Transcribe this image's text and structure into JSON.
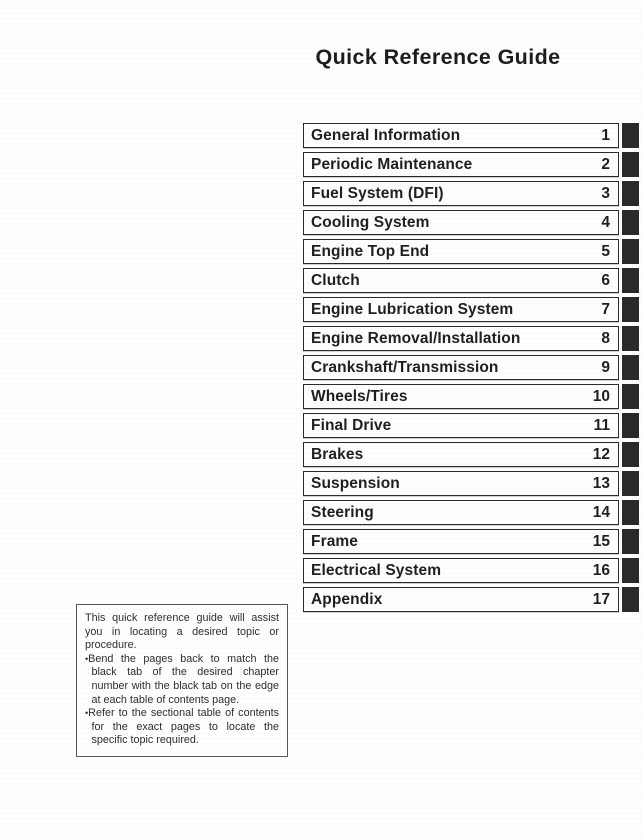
{
  "page": {
    "title": "Quick Reference Guide"
  },
  "chapters": [
    {
      "title": "General Information",
      "number": "1"
    },
    {
      "title": "Periodic Maintenance",
      "number": "2"
    },
    {
      "title": "Fuel System (DFI)",
      "number": "3"
    },
    {
      "title": "Cooling System",
      "number": "4"
    },
    {
      "title": "Engine Top End",
      "number": "5"
    },
    {
      "title": "Clutch",
      "number": "6"
    },
    {
      "title": "Engine Lubrication System",
      "number": "7"
    },
    {
      "title": "Engine Removal/Installation",
      "number": "8"
    },
    {
      "title": "Crankshaft/Transmission",
      "number": "9"
    },
    {
      "title": "Wheels/Tires",
      "number": "10"
    },
    {
      "title": "Final Drive",
      "number": "11"
    },
    {
      "title": "Brakes",
      "number": "12"
    },
    {
      "title": "Suspension",
      "number": "13"
    },
    {
      "title": "Steering",
      "number": "14"
    },
    {
      "title": "Frame",
      "number": "15"
    },
    {
      "title": "Electrical System",
      "number": "16"
    },
    {
      "title": "Appendix",
      "number": "17"
    }
  ],
  "info_box": {
    "paragraph": "This quick reference guide will assist you in locating a desired topic or procedure.",
    "bullets": [
      "Bend the pages back to match the black tab of the desired chapter number with the black tab on the edge at each table of contents page.",
      "Refer to the sectional table of contents for the exact pages to locate the specific topic required."
    ],
    "bullet_glyph": "•"
  },
  "colors": {
    "tab_black": "#2a2a2a",
    "box_border": "#2b2b2b",
    "text": "#1f1f1f",
    "info_border": "#55565a",
    "page_background": "#ffffff"
  }
}
